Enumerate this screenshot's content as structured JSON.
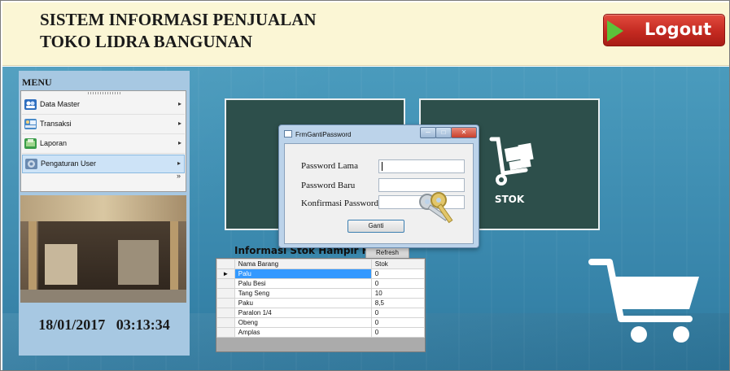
{
  "header": {
    "title_line1": "SISTEM INFORMASI PENJUALAN",
    "title_line2": "TOKO LIDRA BANGUNAN",
    "logout_label": "Logout"
  },
  "menu": {
    "title": "MENU",
    "items": [
      {
        "label": "Data Master",
        "icon": "users-icon",
        "color": "#2f6fbf"
      },
      {
        "label": "Transaksi",
        "icon": "transaction-icon",
        "color": "#4a8bc9"
      },
      {
        "label": "Laporan",
        "icon": "report-icon",
        "color": "#3b9d4a"
      },
      {
        "label": "Pengaturan User",
        "icon": "settings-user-icon",
        "color": "#6a8ab0"
      }
    ],
    "more_glyph": "»"
  },
  "datetime": {
    "date": "18/01/2017",
    "time": "03:13:34"
  },
  "tiles": {
    "stok_label": "STOK"
  },
  "dialog": {
    "title": "FrmGantiPassword",
    "fields": [
      {
        "label": "Password Lama",
        "value": ""
      },
      {
        "label": "Password Baru",
        "value": ""
      },
      {
        "label": "Konfirmasi Password",
        "value": ""
      }
    ],
    "button_label": "Ganti"
  },
  "stock_panel": {
    "title": "Informasi Stok Hampir Habis",
    "refresh_label": "Refresh",
    "columns": [
      "Nama Barang",
      "Stok"
    ],
    "rows": [
      [
        "Palu",
        "0"
      ],
      [
        "Palu Besi",
        "0"
      ],
      [
        "Tang Seng",
        "10"
      ],
      [
        "Paku",
        "8,5"
      ],
      [
        "Paralon 1/4",
        "0"
      ],
      [
        "Obeng",
        "0"
      ],
      [
        "Amplas",
        "0"
      ]
    ],
    "selected_row": 0,
    "current_row_marker": "►"
  },
  "colors": {
    "background": "#3a88ad",
    "tile": "#2d4f4b",
    "logout": "#c42a21",
    "selection": "#3399ff"
  }
}
